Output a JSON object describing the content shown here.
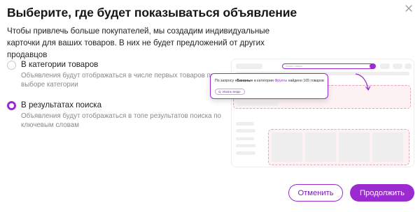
{
  "dialog": {
    "title": "Выберите, где будет показываться объявление",
    "subtitle": "Чтобы привлечь больше покупателей, мы создадим индивидуальные карточки для ваших товаров. В них не будет предложений от других продавцов",
    "close_icon": "close-icon"
  },
  "options": [
    {
      "label": "В категории товаров",
      "description": "Объявления будут отображаться в числе первых товаров при выборе категории",
      "selected": false
    },
    {
      "label": "В результатах поиска",
      "description": "Объявления будут отображаться в топе результатов поиска по ключевым словам",
      "selected": true
    }
  ],
  "illustration": {
    "search_placeholder": "Искать товары",
    "popup_prefix": "По запросу",
    "popup_query": "«Бананы»",
    "popup_middle": "в категории",
    "popup_category": "Фрукты",
    "popup_suffix": "найдено 165 товаров",
    "popup_button": "Искать везде"
  },
  "footer": {
    "cancel_label": "Отменить",
    "continue_label": "Продолжить"
  },
  "colors": {
    "accent": "#9b2bd1",
    "dashed_highlight": "#e6a6b1"
  }
}
